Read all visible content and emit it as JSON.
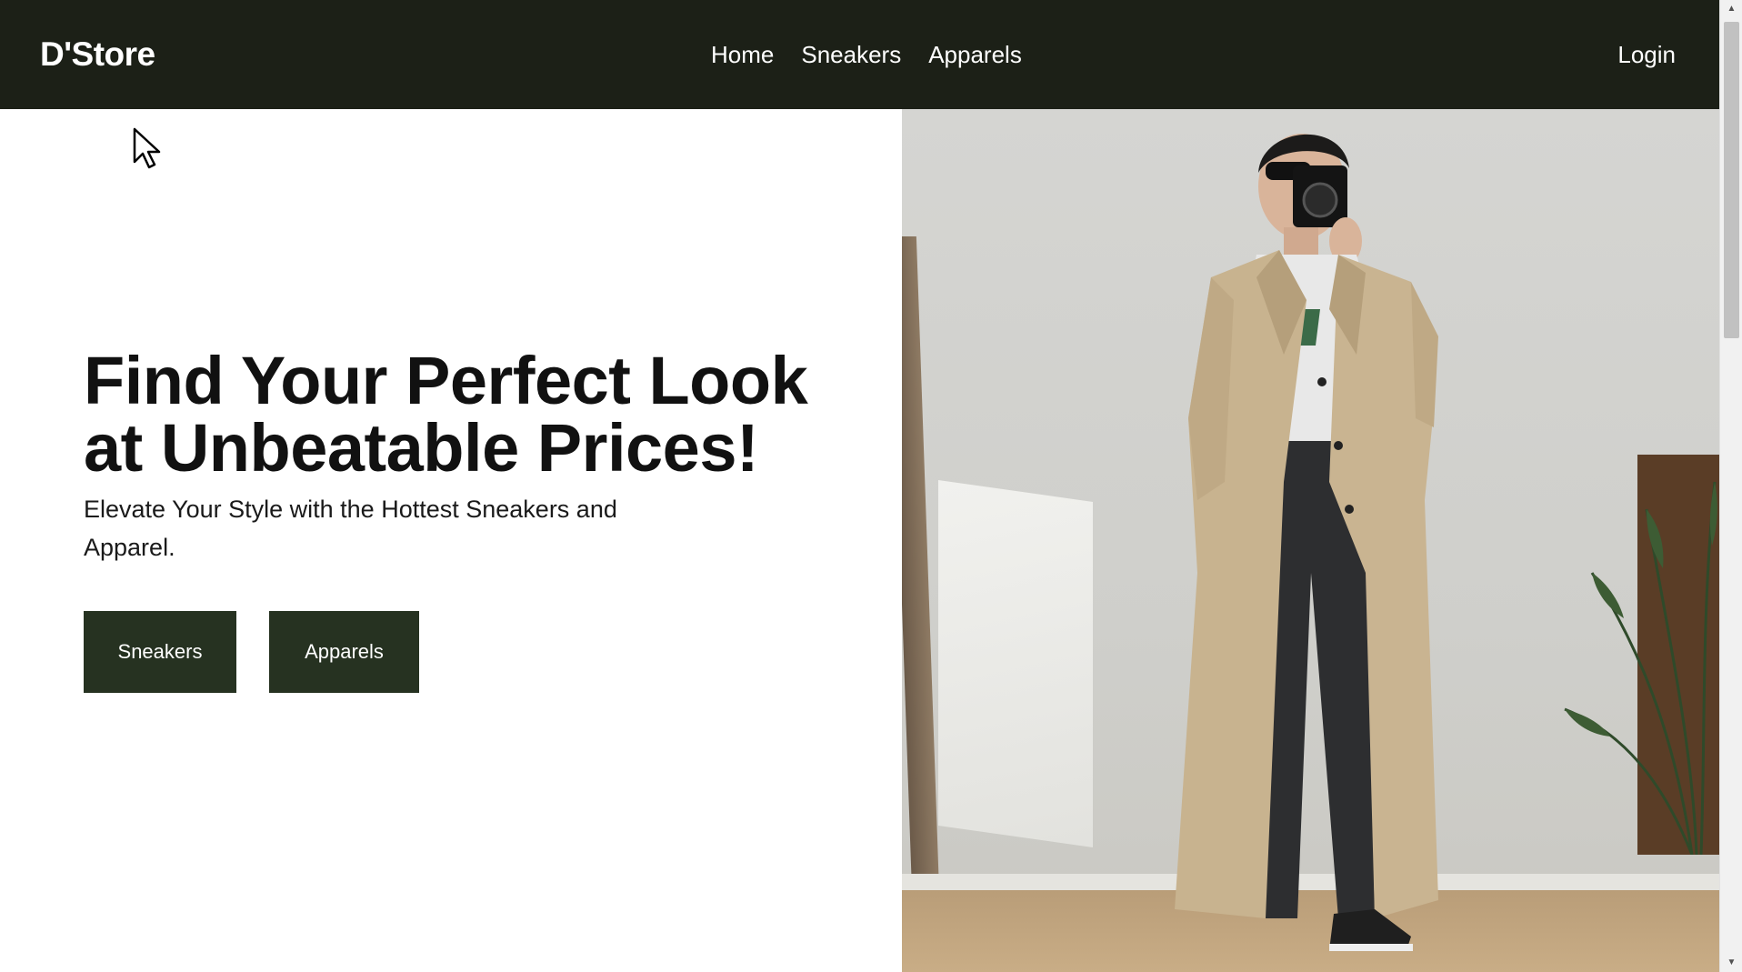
{
  "header": {
    "brand": "D'Store",
    "nav": [
      {
        "label": "Home"
      },
      {
        "label": "Sneakers"
      },
      {
        "label": "Apparels"
      }
    ],
    "login": "Login"
  },
  "hero": {
    "title_line1": "Find Your Perfect Look",
    "title_line2": "at Unbeatable Prices!",
    "subtitle": "Elevate Your Style with the Hottest Sneakers and Apparel.",
    "buttons": [
      {
        "label": "Sneakers"
      },
      {
        "label": "Apparels"
      }
    ],
    "image_alt": "woman in trench coat taking mirror selfie"
  },
  "colors": {
    "header_bg": "#1c2017",
    "button_bg": "#263221",
    "title_text": "#111111"
  }
}
